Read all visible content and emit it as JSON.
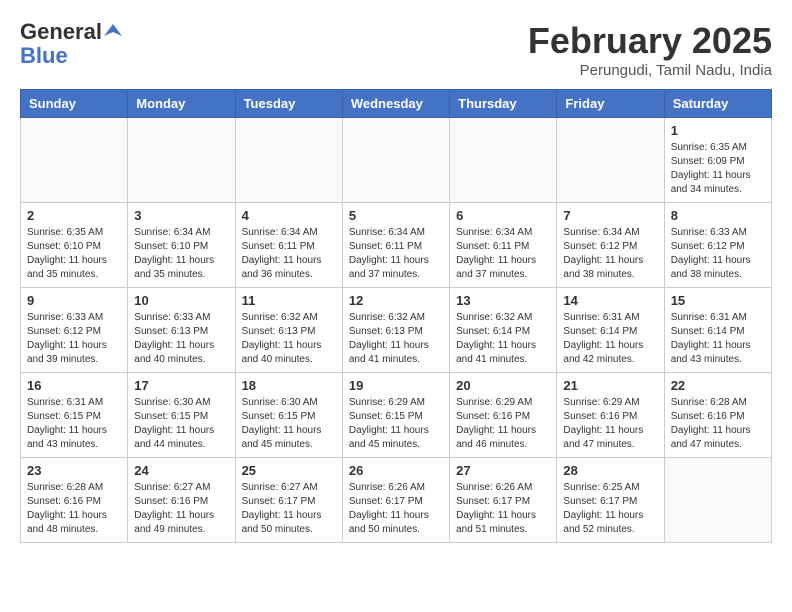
{
  "header": {
    "logo_general": "General",
    "logo_blue": "Blue",
    "month_title": "February 2025",
    "location": "Perungudi, Tamil Nadu, India"
  },
  "weekdays": [
    "Sunday",
    "Monday",
    "Tuesday",
    "Wednesday",
    "Thursday",
    "Friday",
    "Saturday"
  ],
  "weeks": [
    [
      {
        "day": "",
        "info": ""
      },
      {
        "day": "",
        "info": ""
      },
      {
        "day": "",
        "info": ""
      },
      {
        "day": "",
        "info": ""
      },
      {
        "day": "",
        "info": ""
      },
      {
        "day": "",
        "info": ""
      },
      {
        "day": "1",
        "info": "Sunrise: 6:35 AM\nSunset: 6:09 PM\nDaylight: 11 hours\nand 34 minutes."
      }
    ],
    [
      {
        "day": "2",
        "info": "Sunrise: 6:35 AM\nSunset: 6:10 PM\nDaylight: 11 hours\nand 35 minutes."
      },
      {
        "day": "3",
        "info": "Sunrise: 6:34 AM\nSunset: 6:10 PM\nDaylight: 11 hours\nand 35 minutes."
      },
      {
        "day": "4",
        "info": "Sunrise: 6:34 AM\nSunset: 6:11 PM\nDaylight: 11 hours\nand 36 minutes."
      },
      {
        "day": "5",
        "info": "Sunrise: 6:34 AM\nSunset: 6:11 PM\nDaylight: 11 hours\nand 37 minutes."
      },
      {
        "day": "6",
        "info": "Sunrise: 6:34 AM\nSunset: 6:11 PM\nDaylight: 11 hours\nand 37 minutes."
      },
      {
        "day": "7",
        "info": "Sunrise: 6:34 AM\nSunset: 6:12 PM\nDaylight: 11 hours\nand 38 minutes."
      },
      {
        "day": "8",
        "info": "Sunrise: 6:33 AM\nSunset: 6:12 PM\nDaylight: 11 hours\nand 38 minutes."
      }
    ],
    [
      {
        "day": "9",
        "info": "Sunrise: 6:33 AM\nSunset: 6:12 PM\nDaylight: 11 hours\nand 39 minutes."
      },
      {
        "day": "10",
        "info": "Sunrise: 6:33 AM\nSunset: 6:13 PM\nDaylight: 11 hours\nand 40 minutes."
      },
      {
        "day": "11",
        "info": "Sunrise: 6:32 AM\nSunset: 6:13 PM\nDaylight: 11 hours\nand 40 minutes."
      },
      {
        "day": "12",
        "info": "Sunrise: 6:32 AM\nSunset: 6:13 PM\nDaylight: 11 hours\nand 41 minutes."
      },
      {
        "day": "13",
        "info": "Sunrise: 6:32 AM\nSunset: 6:14 PM\nDaylight: 11 hours\nand 41 minutes."
      },
      {
        "day": "14",
        "info": "Sunrise: 6:31 AM\nSunset: 6:14 PM\nDaylight: 11 hours\nand 42 minutes."
      },
      {
        "day": "15",
        "info": "Sunrise: 6:31 AM\nSunset: 6:14 PM\nDaylight: 11 hours\nand 43 minutes."
      }
    ],
    [
      {
        "day": "16",
        "info": "Sunrise: 6:31 AM\nSunset: 6:15 PM\nDaylight: 11 hours\nand 43 minutes."
      },
      {
        "day": "17",
        "info": "Sunrise: 6:30 AM\nSunset: 6:15 PM\nDaylight: 11 hours\nand 44 minutes."
      },
      {
        "day": "18",
        "info": "Sunrise: 6:30 AM\nSunset: 6:15 PM\nDaylight: 11 hours\nand 45 minutes."
      },
      {
        "day": "19",
        "info": "Sunrise: 6:29 AM\nSunset: 6:15 PM\nDaylight: 11 hours\nand 45 minutes."
      },
      {
        "day": "20",
        "info": "Sunrise: 6:29 AM\nSunset: 6:16 PM\nDaylight: 11 hours\nand 46 minutes."
      },
      {
        "day": "21",
        "info": "Sunrise: 6:29 AM\nSunset: 6:16 PM\nDaylight: 11 hours\nand 47 minutes."
      },
      {
        "day": "22",
        "info": "Sunrise: 6:28 AM\nSunset: 6:16 PM\nDaylight: 11 hours\nand 47 minutes."
      }
    ],
    [
      {
        "day": "23",
        "info": "Sunrise: 6:28 AM\nSunset: 6:16 PM\nDaylight: 11 hours\nand 48 minutes."
      },
      {
        "day": "24",
        "info": "Sunrise: 6:27 AM\nSunset: 6:16 PM\nDaylight: 11 hours\nand 49 minutes."
      },
      {
        "day": "25",
        "info": "Sunrise: 6:27 AM\nSunset: 6:17 PM\nDaylight: 11 hours\nand 50 minutes."
      },
      {
        "day": "26",
        "info": "Sunrise: 6:26 AM\nSunset: 6:17 PM\nDaylight: 11 hours\nand 50 minutes."
      },
      {
        "day": "27",
        "info": "Sunrise: 6:26 AM\nSunset: 6:17 PM\nDaylight: 11 hours\nand 51 minutes."
      },
      {
        "day": "28",
        "info": "Sunrise: 6:25 AM\nSunset: 6:17 PM\nDaylight: 11 hours\nand 52 minutes."
      },
      {
        "day": "",
        "info": ""
      }
    ]
  ]
}
